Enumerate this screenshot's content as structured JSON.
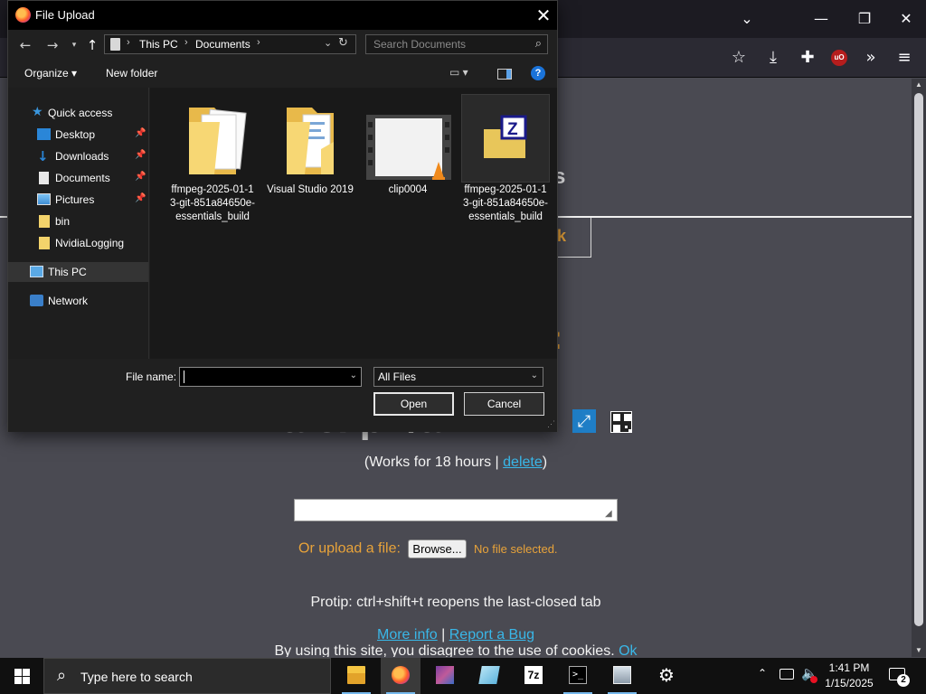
{
  "dialog": {
    "title": "File Upload",
    "address_parts": [
      "This PC",
      "Documents"
    ],
    "search_placeholder": "Search Documents",
    "commands": {
      "organize": "Organize",
      "new_folder": "New folder"
    },
    "nav_items": [
      {
        "label": "Quick access",
        "icon": "star-icon",
        "pinned": false
      },
      {
        "label": "Desktop",
        "icon": "desktop-icon",
        "pinned": true
      },
      {
        "label": "Downloads",
        "icon": "download-arrow-icon",
        "pinned": true
      },
      {
        "label": "Documents",
        "icon": "document-icon",
        "pinned": true
      },
      {
        "label": "Pictures",
        "icon": "pictures-icon",
        "pinned": true
      },
      {
        "label": "bin",
        "icon": "folder-icon",
        "pinned": false
      },
      {
        "label": "NvidiaLogging",
        "icon": "folder-icon",
        "pinned": false
      },
      {
        "label": "This PC",
        "icon": "computer-icon",
        "pinned": false,
        "selected": true
      },
      {
        "label": "Network",
        "icon": "network-icon",
        "pinned": false
      }
    ],
    "files": [
      {
        "name": "ffmpeg-2025-01-13-git-851a84650e-essentials_build",
        "icon": "folder-with-files-icon"
      },
      {
        "name": "Visual Studio 2019",
        "icon": "folder-with-files-icon"
      },
      {
        "name": "clip0004",
        "icon": "video-file-icon"
      },
      {
        "name": "ffmpeg-2025-01-13-git-851a84650e-essentials_build",
        "icon": "zip-archive-icon",
        "selected": true
      }
    ],
    "filename_label": "File name:",
    "filename_value": "",
    "filetype_value": "All Files",
    "open_label": "Open",
    "cancel_label": "Cancel"
  },
  "page": {
    "title_tail": "s",
    "header_button_tail": "k",
    "heading_tail": "k:",
    "url_text": "a.el.pn/am",
    "works_prefix": "(Works for 18 hours | ",
    "delete_link": "delete",
    "works_suffix": ")",
    "upload_label": "Or upload a file:",
    "browse_label": "Browse...",
    "no_file_label": "No file selected.",
    "protip": "Protip: ctrl+shift+t reopens the last-closed tab",
    "more_info": "More info",
    "links_sep": " | ",
    "report_bug": "Report a Bug",
    "cookie_text": "By using this site, you disagree to the use of cookies. ",
    "cookie_ok": "Ok"
  },
  "taskbar": {
    "search_placeholder": "Type here to search",
    "apps": [
      "file-explorer-icon",
      "firefox-icon",
      "winrar-icon",
      "notepad-icon",
      "7zip-icon",
      "terminal-icon",
      "computer-app-icon",
      "settings-gear-icon"
    ],
    "seven_zip_label": "7z",
    "time": "1:41 PM",
    "date": "1/15/2025",
    "notification_count": "2"
  },
  "colors": {
    "accent_orange": "#e8a33a",
    "link_blue": "#39b7e8",
    "page_bg": "#4a4a52",
    "dialog_bg": "#202020",
    "taskbar_bg": "#101010"
  }
}
